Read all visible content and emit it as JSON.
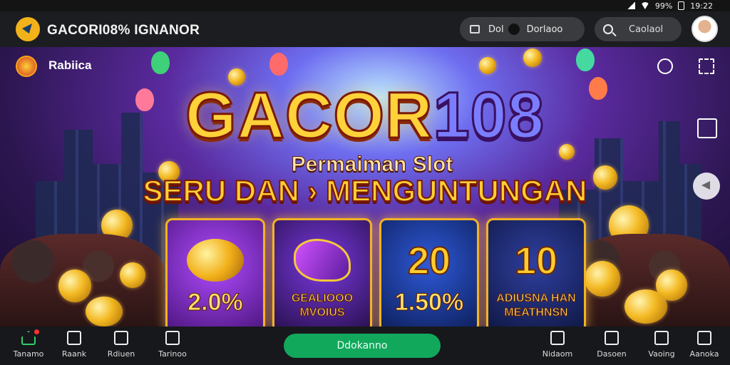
{
  "status_bar": {
    "battery": "99%",
    "time": "19:22"
  },
  "header": {
    "app_title": "GACORI08% IGNANOR",
    "account_pill": {
      "label_left": "Dol",
      "label_right": "Dorlaoo"
    },
    "search": {
      "value": "Caolaol"
    }
  },
  "hero": {
    "brand_name": "Rabiica",
    "title_part1": "GACOR",
    "title_part2": "108",
    "subtitle": "Permaiman Slot",
    "headline": "SERU DAN › MENGUNTUNGAN",
    "cards": [
      {
        "value": "2.0%"
      },
      {
        "line1": "GEALIOOO",
        "line2": "MVOIUS"
      },
      {
        "art_text": "20",
        "value": "1.50%"
      },
      {
        "art_text": "10",
        "line1": "ADIUSNA HAN",
        "line2": "MEATHNSN"
      }
    ]
  },
  "bottom_nav": {
    "items": [
      {
        "label": "Tanamo"
      },
      {
        "label": "Raank"
      },
      {
        "label": "Rdiuen"
      },
      {
        "label": "Tarinoo"
      },
      {
        "label": "Nidaom"
      },
      {
        "label": "Dasoen"
      },
      {
        "label": "Vaoing"
      },
      {
        "label": "Aanoka"
      }
    ],
    "cta_label": "Ddokanno"
  },
  "colors": {
    "accent_green": "#11a85c",
    "title_gold": "#ffd23a",
    "title_purple": "#7b7dff",
    "card_border": "#f2b325",
    "header_bg": "#1c1d20"
  },
  "icons": [
    "gacor-logo-icon",
    "lock-icon",
    "search-icon",
    "chat-icon",
    "expand-icon",
    "window-icon",
    "back-arrow-icon",
    "home-icon",
    "trophy-icon",
    "people-icon",
    "inbox-icon",
    "nav-search-icon",
    "shop-icon",
    "window-icon",
    "share-icon"
  ]
}
